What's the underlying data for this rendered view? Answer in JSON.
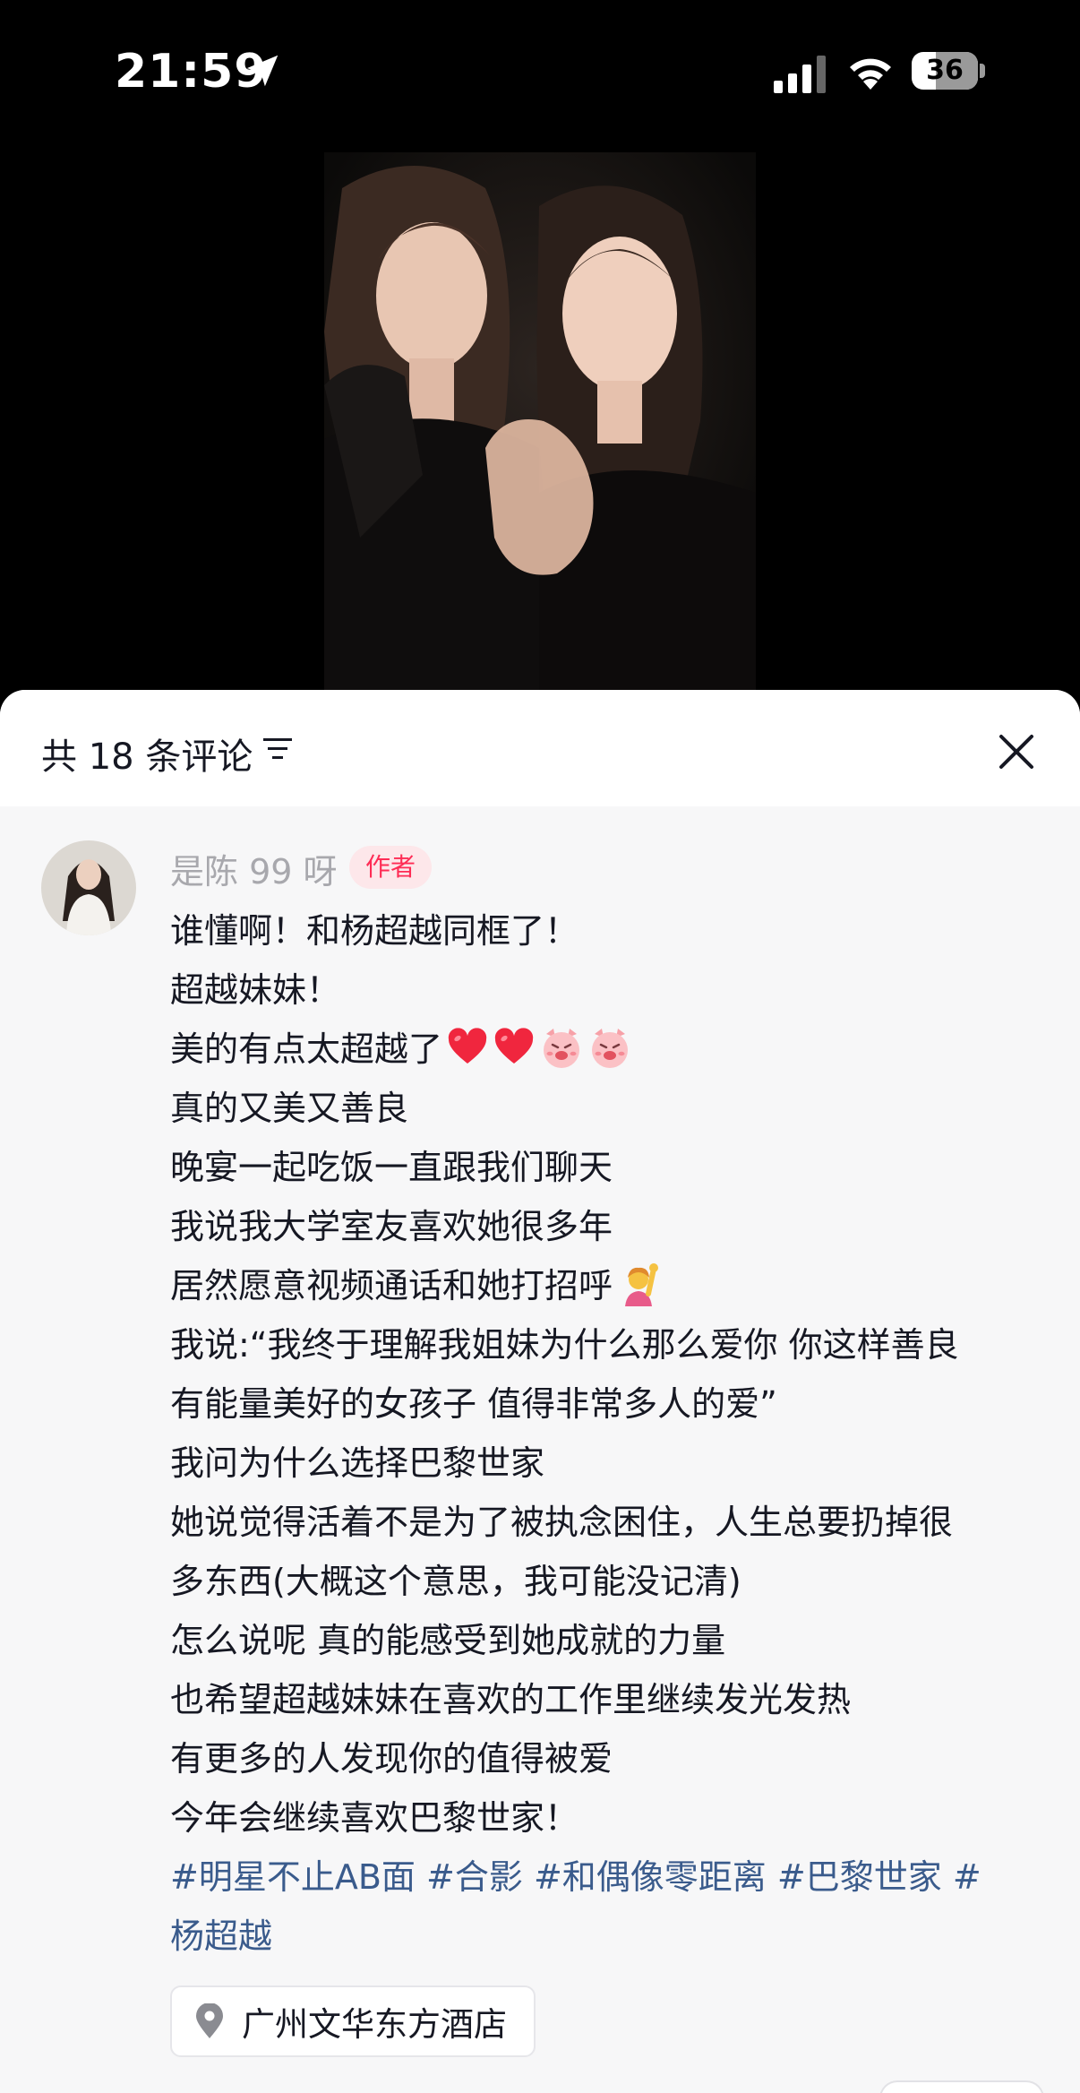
{
  "status_bar": {
    "time": "21:59",
    "battery_level": "36"
  },
  "comments_panel": {
    "count_label": "共 18 条评论"
  },
  "comment": {
    "author_name": "是陈 99 呀",
    "author_badge": "作者",
    "lines": {
      "l1": "谁懂啊！和杨超越同框了！",
      "l2": "超越妹妹！",
      "l3": "美的有点太超越了",
      "l4": "真的又美又善良",
      "l5": "晚宴一起吃饭一直跟我们聊天",
      "l6": "我说我大学室友喜欢她很多年",
      "l7": "居然愿意视频通话和她打招呼",
      "l8": "我说:“我终于理解我姐妹为什么那么爱你 你这样善良",
      "l9": "有能量美好的女孩子 值得非常多人的爱”",
      "l10": "我问为什么选择巴黎世家",
      "l11": "她说觉得活着不是为了被执念困住，人生总要扔掉很",
      "l12": "多东西(大概这个意思，我可能没记清)",
      "l13": "怎么说呢 真的能感受到她成就的力量",
      "l14": "也希望超越妹妹在喜欢的工作里继续发光发热",
      "l15": "有更多的人发现你的值得被爱",
      "l16": "今年会继续喜欢巴黎世家！"
    },
    "hashtags": {
      "t1": "#明星不止AB面",
      "t2": "#合影",
      "t3": "#和偶像零距离",
      "t4": "#巴黎世家",
      "t5": "#",
      "t5_cont": "杨超越"
    },
    "location": "广州文华东方酒店"
  },
  "icons": {
    "status": [
      "location-arrow-icon",
      "cellular-signal-icon",
      "wifi-icon",
      "battery-icon"
    ],
    "header": [
      "filter-icon",
      "close-icon"
    ],
    "emoji": [
      "red-heart-emoji",
      "red-heart-emoji",
      "pig-face-emoji",
      "pig-face-emoji",
      "person-raising-hand-emoji"
    ],
    "location": "location-pin-icon"
  },
  "colors": {
    "badge_text": "#fe2c55",
    "badge_bg": "#fde7ea",
    "hashtag": "#3a5b8c",
    "author_name": "#a8a8ad"
  }
}
